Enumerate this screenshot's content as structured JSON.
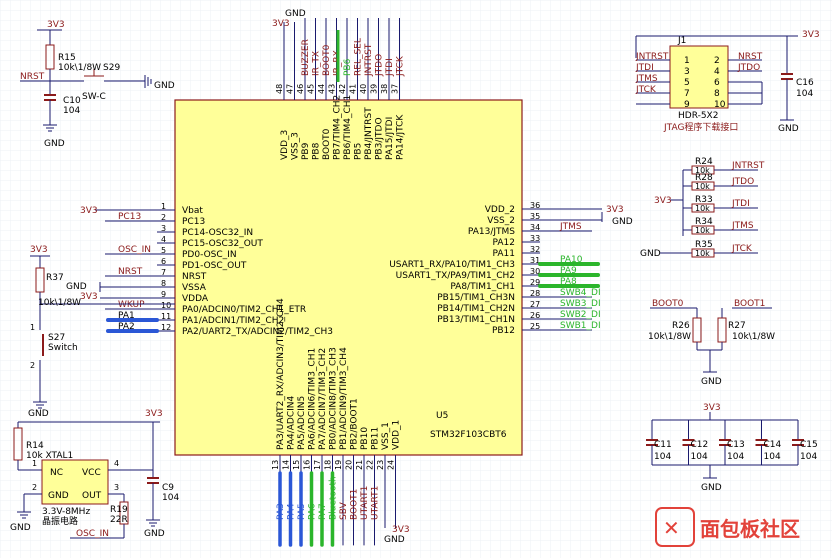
{
  "colors": {
    "background": "#ffffff",
    "grid": "#eef0f6",
    "chip_fill": "#ffff99",
    "chip_stroke": "#8b1a1a",
    "wire": "#1a1a6e",
    "component": "#8b1a1a",
    "netlabel": "#8b1a1a",
    "text": "#000000",
    "highlight_green": "#2bb52b",
    "highlight_blue": "#2b57d6",
    "watermark": "#e2423a"
  },
  "mcu": {
    "designator": "U5",
    "part": "STM32F103CBT6",
    "left_pins": [
      {
        "num": "1",
        "name": "Vbat",
        "net": ""
      },
      {
        "num": "2",
        "name": "PC13",
        "net": "PC13"
      },
      {
        "num": "3",
        "name": "PC14-OSC32_IN",
        "net": ""
      },
      {
        "num": "4",
        "name": "PC15-OSC32_OUT",
        "net": ""
      },
      {
        "num": "5",
        "name": "PD0-OSC_IN",
        "net": "OSC_IN"
      },
      {
        "num": "6",
        "name": "PD1-OSC_OUT",
        "net": ""
      },
      {
        "num": "7",
        "name": "NRST",
        "net": "NRST"
      },
      {
        "num": "8",
        "name": "VSSA",
        "net": "GND"
      },
      {
        "num": "9",
        "name": "VDDA",
        "net": "3V3"
      },
      {
        "num": "10",
        "name": "PA0/ADCIN0/TIM2_CH1_ETR",
        "net": "WKUP"
      },
      {
        "num": "11",
        "name": "PA1/ADCIN1/TIM2_CH2",
        "net": "PA1"
      },
      {
        "num": "12",
        "name": "PA2/UART2_TX/ADCIN2/TIM2_CH3",
        "net": "PA2"
      }
    ],
    "right_pins": [
      {
        "num": "36",
        "name": "VDD_2",
        "net": "3V3"
      },
      {
        "num": "35",
        "name": "VSS_2",
        "net": "GND"
      },
      {
        "num": "34",
        "name": "PA13/JTMS",
        "net": "JTMS"
      },
      {
        "num": "33",
        "name": "PA12",
        "net": ""
      },
      {
        "num": "32",
        "name": "PA11",
        "net": ""
      },
      {
        "num": "31",
        "name": "USART1_RX/PA10/TIM1_CH3",
        "net": "PA10"
      },
      {
        "num": "30",
        "name": "USART1_TX/PA9/TIM1_CH2",
        "net": "PA9"
      },
      {
        "num": "29",
        "name": "PA8/TIM1_CH1",
        "net": "PA8"
      },
      {
        "num": "28",
        "name": "PB15/TIM1_CH3N",
        "net": "SWB4_DI"
      },
      {
        "num": "27",
        "name": "PB14/TIM1_CH2N",
        "net": "SWB3_DI"
      },
      {
        "num": "26",
        "name": "PB13/TIM1_CH1N",
        "net": "SWB2_DI"
      },
      {
        "num": "25",
        "name": "PB12",
        "net": "SWB1_DI"
      }
    ],
    "top_pins": [
      {
        "num": "48",
        "name": "VDD_3",
        "net": "3V3"
      },
      {
        "num": "47",
        "name": "VSS_3",
        "net": "GND"
      },
      {
        "num": "46",
        "name": "PB9",
        "net": "BUZZER"
      },
      {
        "num": "45",
        "name": "PB8",
        "net": "IR_TX"
      },
      {
        "num": "44",
        "name": "BOOT0",
        "net": "BOOT0"
      },
      {
        "num": "43",
        "name": "PB7/TIM4_CH2",
        "net": "IR_RX"
      },
      {
        "num": "42",
        "name": "PB6/TIM4_CH1",
        "net": "PB6"
      },
      {
        "num": "41",
        "name": "PB5",
        "net": "REL_SEL"
      },
      {
        "num": "40",
        "name": "PB4/JNTRST",
        "net": "JNTRST"
      },
      {
        "num": "39",
        "name": "PB3/JTDO",
        "net": "JTDO"
      },
      {
        "num": "38",
        "name": "PA15/JTDI",
        "net": "JTDI"
      },
      {
        "num": "37",
        "name": "PA14/JTCK",
        "net": "JTCK"
      }
    ],
    "bottom_pins": [
      {
        "num": "13",
        "name": "PA3/UART2_RX/ADCIN3/TIM2_CH4",
        "net": "PA3"
      },
      {
        "num": "14",
        "name": "PA4/ADCIN4",
        "net": "PA4"
      },
      {
        "num": "15",
        "name": "PA5/ADCIN5",
        "net": "PA5"
      },
      {
        "num": "16",
        "name": "PA6/ADCIN6/TIM3_CH1",
        "net": "PA6"
      },
      {
        "num": "17",
        "name": "PA7/ADCIN7/TIM3_CH2",
        "net": "PA7"
      },
      {
        "num": "18",
        "name": "PB0/ADCIN8/TIM3_CH3",
        "net": "Bluetooth"
      },
      {
        "num": "19",
        "name": "PB1/ADCIN9/TIM3_CH4",
        "net": "SBV"
      },
      {
        "num": "20",
        "name": "PB2/BOOT1",
        "net": "BOOT1"
      },
      {
        "num": "21",
        "name": "PB10",
        "net": "UTART1"
      },
      {
        "num": "22",
        "name": "PB11",
        "net": "UTART1"
      },
      {
        "num": "23",
        "name": "VSS_1",
        "net": "GND"
      },
      {
        "num": "24",
        "name": "VDD_1",
        "net": "3V3"
      }
    ]
  },
  "power": {
    "vcc": "3V3",
    "gnd": "GND"
  },
  "reset": {
    "r_label": "R15",
    "r_value": "10k\\1/8W",
    "sw_label": "S29",
    "sw_type": "SW-C",
    "cap_label": "C10",
    "cap_value": "104",
    "net": "NRST"
  },
  "wkup": {
    "r_label": "R37",
    "r_value": "10k\\1/8W",
    "sw_label": "S27",
    "sw_type": "Switch",
    "pin1": "1",
    "pin2": "2"
  },
  "crystal": {
    "r14_label": "R14",
    "r14_value": "10k XTAL1",
    "pin_nc": "NC",
    "pin_vcc": "VCC",
    "pin_gnd": "GND",
    "pin_out": "OUT",
    "pin1": "1",
    "pin2": "2",
    "pin3": "3",
    "pin4": "4",
    "desc1": "3.3V-8MHz",
    "desc2": "晶振电路",
    "r19_label": "R19",
    "r19_value": "22R",
    "c9_label": "C9",
    "c9_value": "104",
    "net": "OSC_IN"
  },
  "jtag": {
    "designator": "J1",
    "part": "HDR-5X2",
    "caption": "JTAG程序下载接口",
    "left_nums": [
      "1",
      "3",
      "5",
      "7",
      "9"
    ],
    "right_nums": [
      "2",
      "4",
      "6",
      "8",
      "10"
    ],
    "left_nets": [
      "JNTRST",
      "JTDI",
      "JTMS",
      "JTCK",
      ""
    ],
    "right_nets": [
      "NRST",
      "JTDO",
      "",
      "",
      ""
    ],
    "cap_label": "C16",
    "cap_value": "104"
  },
  "pullups": [
    {
      "label": "R24",
      "value": "10k",
      "net": "JNTRST"
    },
    {
      "label": "R28",
      "value": "10k",
      "net": "JTDO"
    },
    {
      "label": "R33",
      "value": "10k",
      "net": "JTDI"
    },
    {
      "label": "R34",
      "value": "10k",
      "net": "JTMS"
    },
    {
      "label": "R35",
      "value": "10k",
      "net": "JTCK"
    }
  ],
  "boot": [
    {
      "net": "BOOT0",
      "label": "R26",
      "value": "10k\\1/8W"
    },
    {
      "net": "BOOT1",
      "label": "R27",
      "value": "10k\\1/8W"
    }
  ],
  "decaps": [
    {
      "label": "C11",
      "value": "104"
    },
    {
      "label": "C12",
      "value": "104"
    },
    {
      "label": "C13",
      "value": "104"
    },
    {
      "label": "C14",
      "value": "104"
    },
    {
      "label": "C15",
      "value": "104"
    }
  ],
  "watermark": "面包板社区"
}
